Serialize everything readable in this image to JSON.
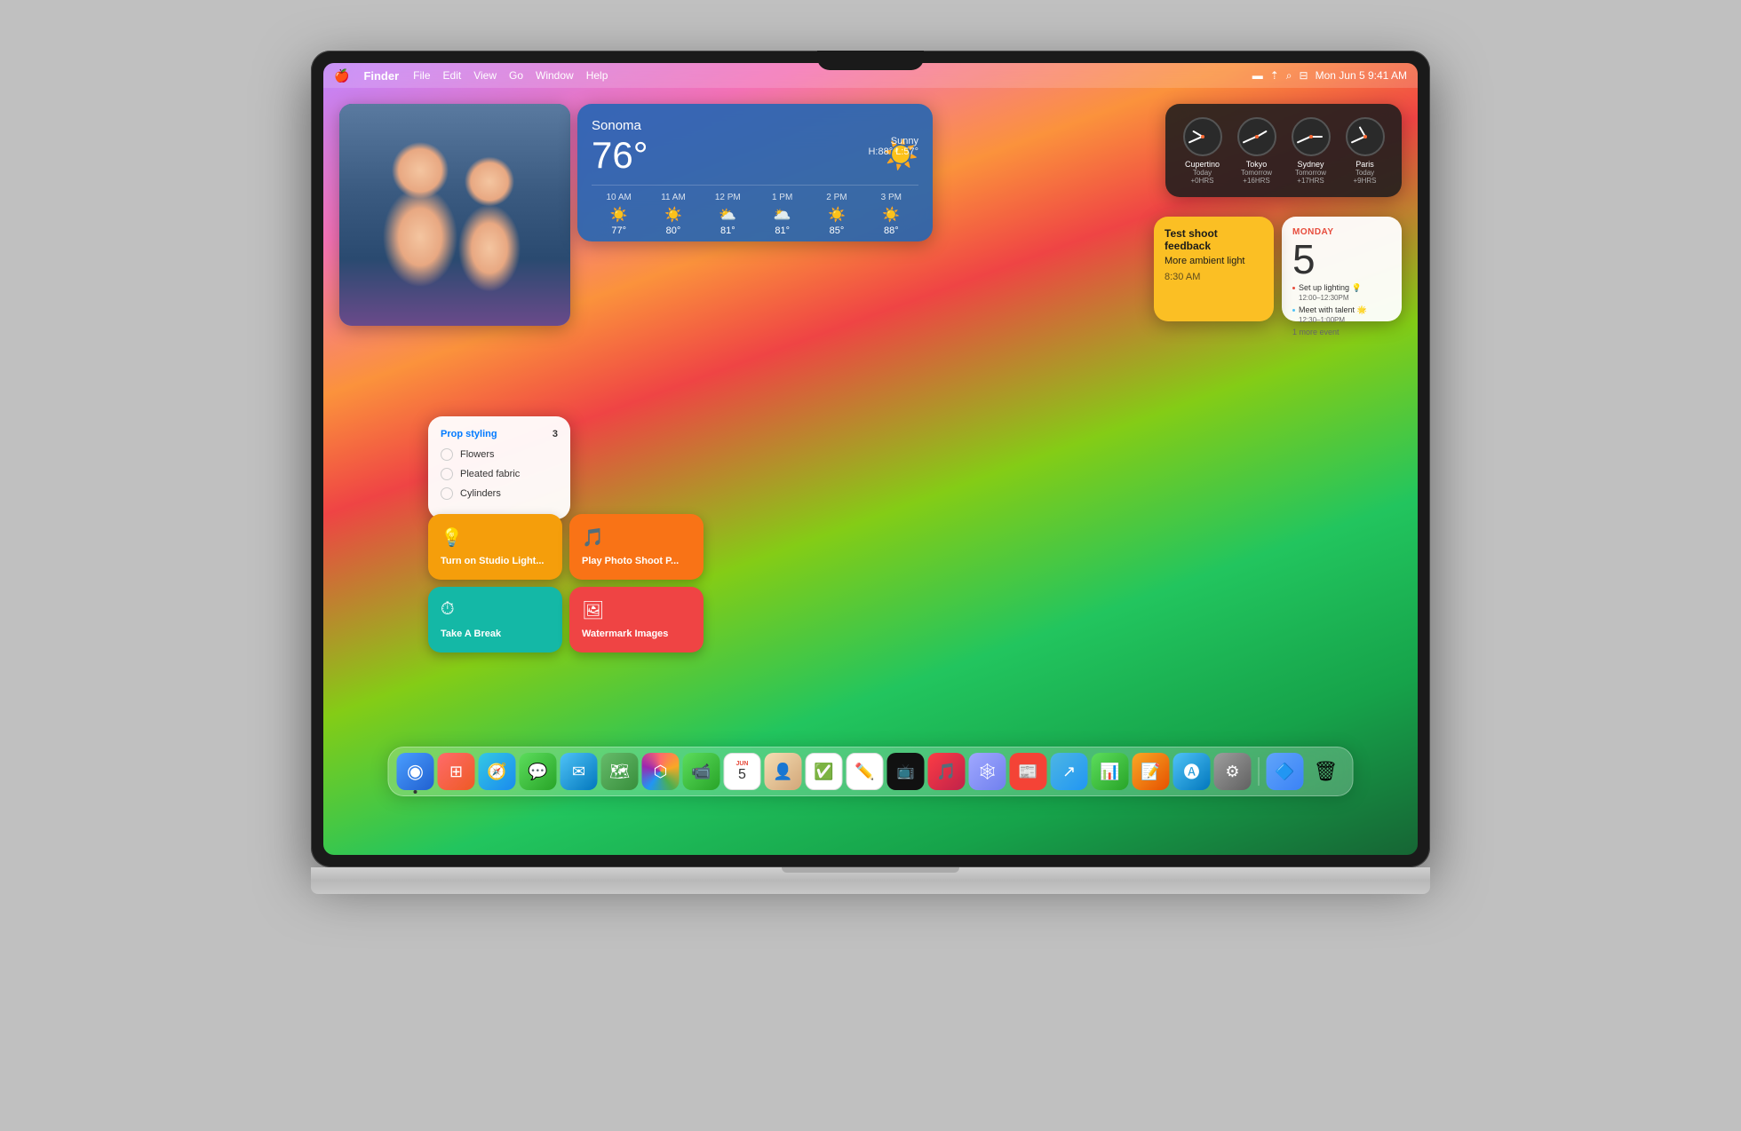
{
  "macbook": {
    "screen": {
      "menubar": {
        "apple": "⌘",
        "app": "Finder",
        "items": [
          "File",
          "Edit",
          "View",
          "Go",
          "Window",
          "Help"
        ],
        "status_icons": [
          "🔋",
          "📶",
          "🔍",
          "💻"
        ],
        "datetime": "Mon Jun 5  9:41 AM"
      },
      "weather": {
        "location": "Sonoma",
        "temp": "76°",
        "condition": "Sunny",
        "hi": "H:88°",
        "lo": "L:57°",
        "forecast": [
          {
            "time": "10 AM",
            "icon": "☀️",
            "temp": "77°"
          },
          {
            "time": "11 AM",
            "icon": "☀️",
            "temp": "80°"
          },
          {
            "time": "12 PM",
            "icon": "⛅",
            "temp": "81°"
          },
          {
            "time": "1 PM",
            "icon": "🌥️",
            "temp": "81°"
          },
          {
            "time": "2 PM",
            "icon": "☀️",
            "temp": "85°"
          },
          {
            "time": "3 PM",
            "icon": "☀️",
            "temp": "88°"
          }
        ]
      },
      "clocks": [
        {
          "city": "Cupertino",
          "day": "Today",
          "offset": "+0HRS",
          "hour_angle": -90,
          "min_angle": 246
        },
        {
          "city": "Tokyo",
          "day": "Tomorrow",
          "offset": "+16HRS",
          "hour_angle": 30,
          "min_angle": 246
        },
        {
          "city": "Sydney",
          "day": "Tomorrow",
          "offset": "+17HRS",
          "hour_angle": 48,
          "min_angle": 246
        },
        {
          "city": "Paris",
          "day": "Today",
          "offset": "+9HRS",
          "hour_angle": -30,
          "min_angle": 246
        }
      ],
      "calendar": {
        "day_name": "MONDAY",
        "date": "5",
        "events": [
          {
            "title": "Set up lighting 💡",
            "time": "12:00–12:30PM",
            "color": "#ff6b6b"
          },
          {
            "title": "Meet with talent 🌟",
            "time": "12:30–1:00PM",
            "color": "#4fc3f7"
          }
        ],
        "more": "1 more event"
      },
      "notes": {
        "title": "Test shoot feedback",
        "content": "More ambient light",
        "time": "8:30 AM"
      },
      "reminders": {
        "title": "Prop styling",
        "count": "3",
        "items": [
          "Flowers",
          "Pleated fabric",
          "Cylinders"
        ]
      },
      "shortcuts": [
        {
          "icon": "💡",
          "label": "Turn on Studio Light...",
          "color": "shortcut-yellow"
        },
        {
          "icon": "🎵",
          "label": "Play Photo Shoot P...",
          "color": "shortcut-orange"
        },
        {
          "icon": "⏱",
          "label": "Take A Break",
          "color": "shortcut-teal"
        },
        {
          "icon": "🖼",
          "label": "Watermark Images",
          "color": "shortcut-red"
        }
      ],
      "dock": {
        "apps": [
          {
            "name": "Finder",
            "emoji": "🔵",
            "class": "finder-icon",
            "active": true
          },
          {
            "name": "Launchpad",
            "emoji": "⊞",
            "class": "launchpad-icon",
            "active": false
          },
          {
            "name": "Safari",
            "emoji": "🧭",
            "class": "safari-icon",
            "active": false
          },
          {
            "name": "Messages",
            "emoji": "💬",
            "class": "messages-icon",
            "active": false
          },
          {
            "name": "Mail",
            "emoji": "✉",
            "class": "mail-icon",
            "active": false
          },
          {
            "name": "Maps",
            "emoji": "🗺",
            "class": "maps-icon",
            "active": false
          },
          {
            "name": "Photos",
            "emoji": "📷",
            "class": "photos-icon",
            "active": false
          },
          {
            "name": "FaceTime",
            "emoji": "📹",
            "class": "facetime-icon",
            "active": false
          },
          {
            "name": "Calendar",
            "emoji": "📅",
            "class": "calendar-icon",
            "active": false
          },
          {
            "name": "Contacts",
            "emoji": "👤",
            "class": "contacts-icon",
            "active": false
          },
          {
            "name": "Reminders",
            "emoji": "✅",
            "class": "reminders-icon",
            "active": false
          },
          {
            "name": "Freeform",
            "emoji": "✏",
            "class": "freeform-icon",
            "active": false
          },
          {
            "name": "Apple TV",
            "emoji": "📺",
            "class": "appletv-icon",
            "active": false
          },
          {
            "name": "Music",
            "emoji": "🎵",
            "class": "music-icon",
            "active": false
          },
          {
            "name": "MindNode",
            "emoji": "🕸",
            "class": "freeform2-icon",
            "active": false
          },
          {
            "name": "News",
            "emoji": "📰",
            "class": "news-icon",
            "active": false
          },
          {
            "name": "Migration",
            "emoji": "↗",
            "class": "migration-icon",
            "active": false
          },
          {
            "name": "Numbers",
            "emoji": "📊",
            "class": "numbers-icon",
            "active": false
          },
          {
            "name": "Pages",
            "emoji": "📝",
            "class": "pages-icon",
            "active": false
          },
          {
            "name": "App Store",
            "emoji": "🅐",
            "class": "appstore-icon",
            "active": false
          },
          {
            "name": "System Settings",
            "emoji": "⚙",
            "class": "settings-icon",
            "active": false
          },
          {
            "name": "Unknown",
            "emoji": "🔷",
            "class": "unknown-icon",
            "active": false
          },
          {
            "name": "Trash",
            "emoji": "🗑",
            "class": "trash-icon",
            "active": false
          }
        ]
      }
    }
  }
}
